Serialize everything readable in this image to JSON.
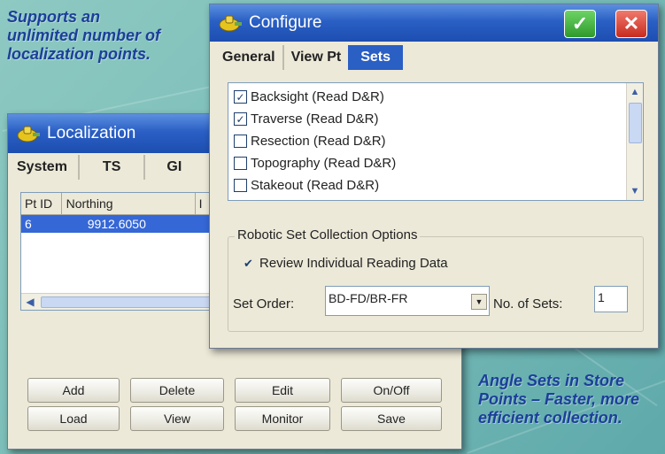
{
  "captions": {
    "top_left": [
      "Supports an",
      "unlimited number of",
      "localization points."
    ],
    "bottom_right": [
      "Angle Sets in Store",
      "Points – Faster, more",
      "efficient collection."
    ]
  },
  "localization": {
    "title": "Localization",
    "tabs": [
      "System",
      "TS",
      "GI"
    ],
    "table": {
      "headers": [
        "Pt ID",
        "Northing",
        "I"
      ],
      "rows": [
        [
          "6",
          "9912.6050"
        ]
      ]
    },
    "buttons": {
      "add": "Add",
      "delete": "Delete",
      "edit": "Edit",
      "on_off": "On/Off",
      "load": "Load",
      "view": "View",
      "monitor": "Monitor",
      "save": "Save"
    }
  },
  "configure": {
    "title": "Configure",
    "ok_icon": "check-icon",
    "close_icon": "close-icon",
    "tabs": [
      "General",
      "View Pt",
      "Sets"
    ],
    "active_tab": "Sets",
    "sets": [
      {
        "label": "Backsight (Read D&R)",
        "checked": true
      },
      {
        "label": "Traverse (Read D&R)",
        "checked": true
      },
      {
        "label": "Resection (Read D&R)",
        "checked": false
      },
      {
        "label": "Topography (Read D&R)",
        "checked": false
      },
      {
        "label": "Stakeout (Read D&R)",
        "checked": false
      }
    ],
    "robotic_group_label": "Robotic Set Collection Options",
    "review_label": "Review Individual Reading Data",
    "review_checked": true,
    "set_order_label": "Set Order:",
    "set_order_value": "BD-FD/BR-FR",
    "num_sets_label": "No. of Sets:",
    "num_sets_value": "1"
  },
  "colors": {
    "caption": "#1b3f9a",
    "titlebar": "#2a5fc4",
    "selection": "#3567d6",
    "ok_button": "#3fae3a",
    "close_button": "#d9352a"
  }
}
